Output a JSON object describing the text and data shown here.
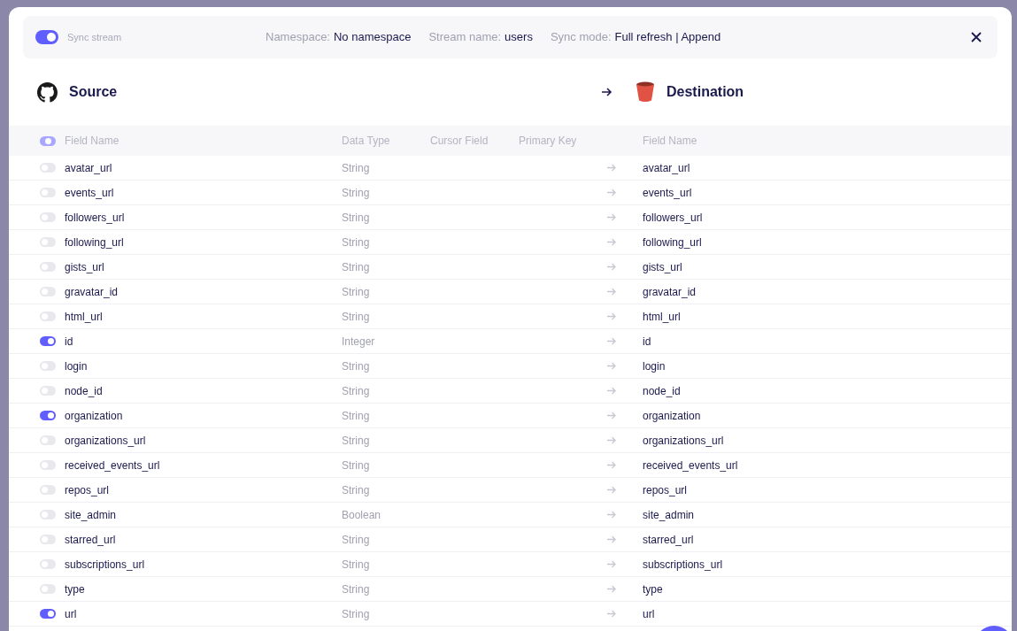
{
  "stream_bar": {
    "sync_stream": {
      "label": "Sync stream",
      "on": true
    },
    "namespace": {
      "label": "Namespace:",
      "value": "No namespace"
    },
    "stream_name": {
      "label": "Stream name:",
      "value": "users"
    },
    "sync_mode": {
      "label": "Sync mode:",
      "value": "Full refresh | Append"
    }
  },
  "source": {
    "title": "Source"
  },
  "destination": {
    "title": "Destination"
  },
  "columns": {
    "select_all": {
      "checked": false,
      "indeterminate": true
    },
    "field_name": "Field Name",
    "data_type": "Data Type",
    "cursor_field": "Cursor Field",
    "primary_key": "Primary Key",
    "destination_field": "Field Name"
  },
  "rows": [
    {
      "name": "avatar_url",
      "type": "String",
      "dest": "avatar_url",
      "on": false
    },
    {
      "name": "events_url",
      "type": "String",
      "dest": "events_url",
      "on": false
    },
    {
      "name": "followers_url",
      "type": "String",
      "dest": "followers_url",
      "on": false
    },
    {
      "name": "following_url",
      "type": "String",
      "dest": "following_url",
      "on": false
    },
    {
      "name": "gists_url",
      "type": "String",
      "dest": "gists_url",
      "on": false
    },
    {
      "name": "gravatar_id",
      "type": "String",
      "dest": "gravatar_id",
      "on": false
    },
    {
      "name": "html_url",
      "type": "String",
      "dest": "html_url",
      "on": false
    },
    {
      "name": "id",
      "type": "Integer",
      "dest": "id",
      "on": true
    },
    {
      "name": "login",
      "type": "String",
      "dest": "login",
      "on": false
    },
    {
      "name": "node_id",
      "type": "String",
      "dest": "node_id",
      "on": false
    },
    {
      "name": "organization",
      "type": "String",
      "dest": "organization",
      "on": true
    },
    {
      "name": "organizations_url",
      "type": "String",
      "dest": "organizations_url",
      "on": false
    },
    {
      "name": "received_events_url",
      "type": "String",
      "dest": "received_events_url",
      "on": false
    },
    {
      "name": "repos_url",
      "type": "String",
      "dest": "repos_url",
      "on": false
    },
    {
      "name": "site_admin",
      "type": "Boolean",
      "dest": "site_admin",
      "on": false
    },
    {
      "name": "starred_url",
      "type": "String",
      "dest": "starred_url",
      "on": false
    },
    {
      "name": "subscriptions_url",
      "type": "String",
      "dest": "subscriptions_url",
      "on": false
    },
    {
      "name": "type",
      "type": "String",
      "dest": "type",
      "on": false
    },
    {
      "name": "url",
      "type": "String",
      "dest": "url",
      "on": true
    }
  ]
}
